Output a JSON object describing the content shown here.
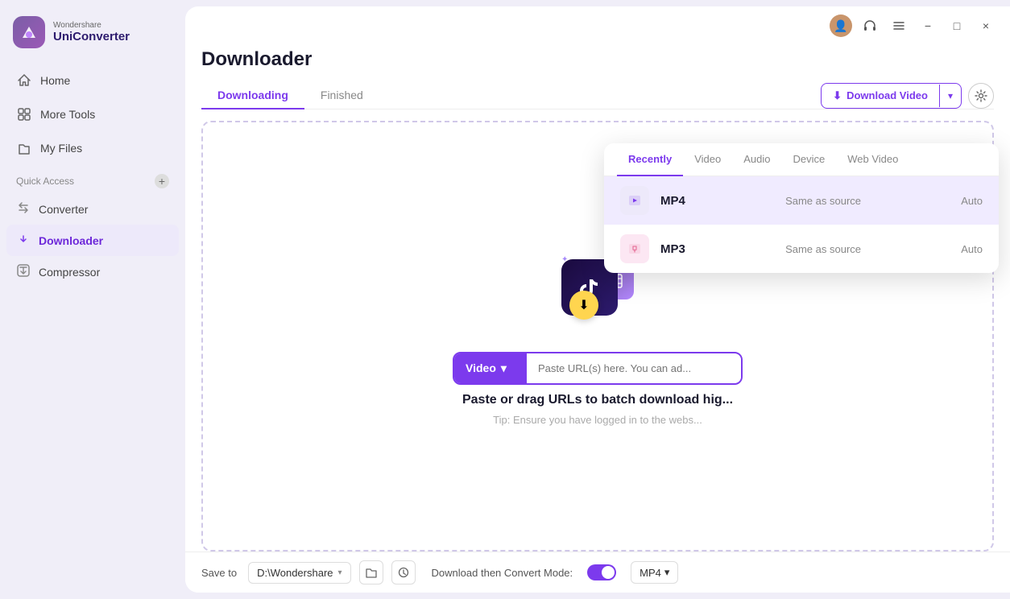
{
  "app": {
    "brand": "Wondershare",
    "name": "UniConverter"
  },
  "titlebar": {
    "minimize": "−",
    "maximize": "□",
    "close": "×"
  },
  "sidebar": {
    "nav_items": [
      {
        "id": "home",
        "label": "Home",
        "icon": "🏠"
      },
      {
        "id": "more-tools",
        "label": "More Tools",
        "icon": "⊞"
      },
      {
        "id": "my-files",
        "label": "My Files",
        "icon": "📁"
      }
    ],
    "quick_access_label": "Quick Access",
    "quick_access_add": "+",
    "sub_items": [
      {
        "id": "converter",
        "label": "Converter",
        "icon": "↔"
      },
      {
        "id": "downloader",
        "label": "Downloader",
        "icon": "⬇",
        "active": true
      },
      {
        "id": "compressor",
        "label": "Compressor",
        "icon": "🗜"
      }
    ]
  },
  "main": {
    "page_title": "Downloader",
    "tabs": [
      {
        "id": "downloading",
        "label": "Downloading",
        "active": true
      },
      {
        "id": "finished",
        "label": "Finished"
      }
    ],
    "download_btn_label": "Download Video",
    "download_btn_icon": "⬇",
    "url_input_placeholder": "Paste URL(s) here. You can ad...",
    "url_type_label": "Video",
    "drop_title": "Paste or drag URLs to batch download hig...",
    "drop_tip": "Tip: Ensure you have logged in to the webs..."
  },
  "bottom_bar": {
    "save_to_label": "Save to",
    "save_path": "D:\\Wondershare",
    "convert_mode_label": "Download then Convert Mode:",
    "format_label": "MP4"
  },
  "popup": {
    "tabs": [
      {
        "id": "recently",
        "label": "Recently",
        "active": true
      },
      {
        "id": "video",
        "label": "Video"
      },
      {
        "id": "audio",
        "label": "Audio"
      },
      {
        "id": "device",
        "label": "Device"
      },
      {
        "id": "web-video",
        "label": "Web Video"
      }
    ],
    "items": [
      {
        "id": "mp4",
        "format": "MP4",
        "icon_type": "video",
        "source": "Same as source",
        "quality": "Auto",
        "selected": true
      },
      {
        "id": "mp3",
        "format": "MP3",
        "icon_type": "audio",
        "source": "Same as source",
        "quality": "Auto",
        "selected": false
      }
    ]
  }
}
